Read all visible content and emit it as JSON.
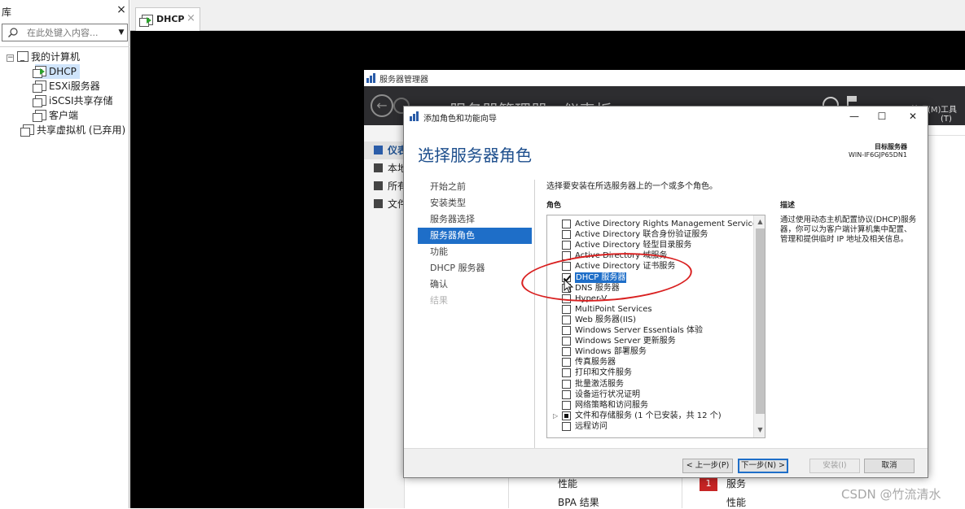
{
  "library": {
    "title": "库",
    "close": "×",
    "search_placeholder": "在此处键入内容...",
    "dropdown": "▼",
    "tree": {
      "root_expander": "−",
      "root": "我的计算机",
      "children": [
        "DHCP",
        "ESXi服务器",
        "iSCSI共享存储",
        "客户端"
      ],
      "shared": "共享虚拟机 (已弃用)"
    }
  },
  "tabs": [
    {
      "label": "DHCP",
      "close": "×"
    }
  ],
  "server_manager": {
    "window_title": "服务器管理器",
    "header_title": "服务器管理器 · 仪表板",
    "back": "←",
    "manage": "管理(M)",
    "tools": "工具(T)",
    "nav": [
      "仪表板",
      "本地服务器",
      "所有服务器",
      "文件和存储服务"
    ],
    "tiles": {
      "left1": "性能",
      "left2": "BPA 结果",
      "badge": "1",
      "right1": "服务",
      "right2": "性能"
    }
  },
  "wizard": {
    "title": "添加角色和功能向导",
    "controls": {
      "minimize": "—",
      "maximize": "☐",
      "close": "✕"
    },
    "heading": "选择服务器角色",
    "target_label": "目标服务器",
    "target_name": "WIN-IF6GJP65DN1",
    "steps": [
      {
        "label": "开始之前",
        "state": "normal"
      },
      {
        "label": "安装类型",
        "state": "normal"
      },
      {
        "label": "服务器选择",
        "state": "normal"
      },
      {
        "label": "服务器角色",
        "state": "active"
      },
      {
        "label": "功能",
        "state": "normal"
      },
      {
        "label": "DHCP 服务器",
        "state": "normal"
      },
      {
        "label": "确认",
        "state": "normal"
      },
      {
        "label": "结果",
        "state": "disabled"
      }
    ],
    "instruction": "选择要安装在所选服务器上的一个或多个角色。",
    "roles_label": "角色",
    "roles": [
      {
        "label": "Active Directory Rights Management Services",
        "check": "none"
      },
      {
        "label": "Active Directory 联合身份验证服务",
        "check": "none"
      },
      {
        "label": "Active Directory 轻型目录服务",
        "check": "none"
      },
      {
        "label": "Active Directory 域服务",
        "check": "none"
      },
      {
        "label": "Active Directory 证书服务",
        "check": "none"
      },
      {
        "label": "DHCP 服务器",
        "check": "checked",
        "selected": true
      },
      {
        "label": "DNS 服务器",
        "check": "none"
      },
      {
        "label": "Hyper-V",
        "check": "none"
      },
      {
        "label": "MultiPoint Services",
        "check": "none"
      },
      {
        "label": "Web 服务器(IIS)",
        "check": "none"
      },
      {
        "label": "Windows Server Essentials 体验",
        "check": "none"
      },
      {
        "label": "Windows Server 更新服务",
        "check": "none"
      },
      {
        "label": "Windows 部署服务",
        "check": "none"
      },
      {
        "label": "传真服务器",
        "check": "none"
      },
      {
        "label": "打印和文件服务",
        "check": "none"
      },
      {
        "label": "批量激活服务",
        "check": "none"
      },
      {
        "label": "设备运行状况证明",
        "check": "none"
      },
      {
        "label": "网络策略和访问服务",
        "check": "none"
      },
      {
        "label": "文件和存储服务 (1 个已安装，共 12 个)",
        "check": "partial",
        "expandable": true
      },
      {
        "label": "远程访问",
        "check": "none"
      }
    ],
    "description_label": "描述",
    "description": "通过使用动态主机配置协议(DHCP)服务器，你可以为客户端计算机集中配置、管理和提供临时 IP 地址及相关信息。",
    "buttons": {
      "prev": "< 上一步(P)",
      "next": "下一步(N) >",
      "install": "安装(I)",
      "cancel": "取消"
    }
  },
  "watermark": "CSDN @竹流清水",
  "colors": {
    "accent": "#1e6ec8",
    "annotation": "#d92020",
    "console": "#000000"
  }
}
